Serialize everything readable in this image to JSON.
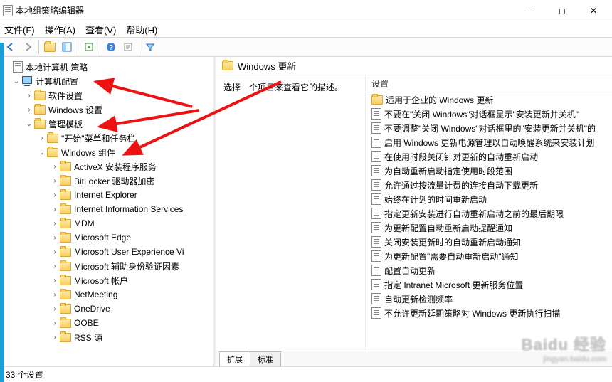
{
  "window": {
    "title": "本地组策略编辑器"
  },
  "menu": {
    "file": "文件(F)",
    "action": "操作(A)",
    "view": "查看(V)",
    "help": "帮助(H)"
  },
  "tree": {
    "root": "本地计算机 策略",
    "computer": "计算机配置",
    "software": "软件设置",
    "windows_settings": "Windows 设置",
    "admin_templates": "管理模板",
    "start_taskbar": "\"开始\"菜单和任务栏",
    "windows_components": "Windows 组件",
    "items": [
      "ActiveX 安装程序服务",
      "BitLocker 驱动器加密",
      "Internet Explorer",
      "Internet Information Services",
      "MDM",
      "Microsoft Edge",
      "Microsoft User Experience Vi",
      "Microsoft 辅助身份验证因素",
      "Microsoft 帐户",
      "NetMeeting",
      "OneDrive",
      "OOBE",
      "RSS 源"
    ]
  },
  "content": {
    "title": "Windows 更新",
    "desc": "选择一个项目来查看它的描述。",
    "col_settings": "设置",
    "folder_item": "适用于企业的 Windows 更新",
    "items": [
      "不要在\"关闭 Windows\"对话框显示\"安装更新并关机\"",
      "不要调整\"关闭 Windows\"对话框里的\"安装更新并关机\"的",
      "启用 Windows 更新电源管理以自动唤醒系统来安装计划",
      "在使用时段关闭针对更新的自动重新启动",
      "为自动重新启动指定使用时段范围",
      "允许通过按流量计费的连接自动下载更新",
      "始终在计划的时间重新启动",
      "指定更新安装进行自动重新启动之前的最后期限",
      "为更新配置自动重新启动提醒通知",
      "关闭安装更新时的自动重新启动通知",
      "为更新配置\"需要自动重新启动\"通知",
      "配置自动更新",
      "指定 Intranet Microsoft 更新服务位置",
      "自动更新检测频率",
      "不允许更新延期策略对 Windows 更新执行扫描"
    ]
  },
  "tabs": {
    "extended": "扩展",
    "standard": "标准"
  },
  "status": {
    "text": "33 个设置"
  },
  "watermark": {
    "brand": "Baidu 经验",
    "url": "jingyan.baidu.com"
  }
}
